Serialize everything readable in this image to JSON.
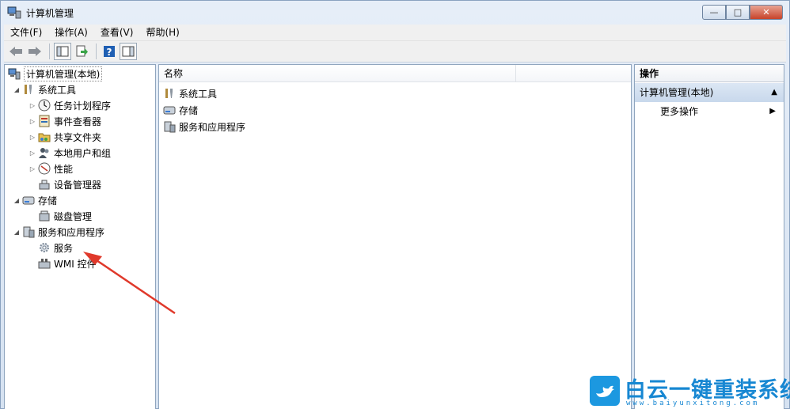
{
  "window": {
    "title": "计算机管理",
    "buttons": {
      "minimize": "—",
      "maximize": "□",
      "close": "✕"
    }
  },
  "menu": [
    "文件(F)",
    "操作(A)",
    "查看(V)",
    "帮助(H)"
  ],
  "toolbar": {
    "icons": [
      "back-arrow-icon",
      "forward-arrow-icon",
      "show-hide-tree-icon",
      "export-list-icon",
      "help-icon",
      "show-hide-action-pane-icon"
    ]
  },
  "tree": {
    "root": "计算机管理(本地)",
    "system_tools": "系统工具",
    "task_scheduler": "任务计划程序",
    "event_viewer": "事件查看器",
    "shared_folders": "共享文件夹",
    "local_users_groups": "本地用户和组",
    "performance": "性能",
    "device_manager": "设备管理器",
    "storage": "存储",
    "disk_management": "磁盘管理",
    "services_apps": "服务和应用程序",
    "services": "服务",
    "wmi_control": "WMI 控件"
  },
  "list": {
    "column_name": "名称",
    "items": [
      "系统工具",
      "存储",
      "服务和应用程序"
    ]
  },
  "actions": {
    "title": "操作",
    "section": "计算机管理(本地)",
    "more": "更多操作"
  },
  "watermark": {
    "name": "白云一键重装系统",
    "url": "www.baiyunxitong.com"
  },
  "colors": {
    "accent_blue": "#1787d2",
    "arrow_red": "#e0392b",
    "pane_border": "#8fa5be"
  }
}
